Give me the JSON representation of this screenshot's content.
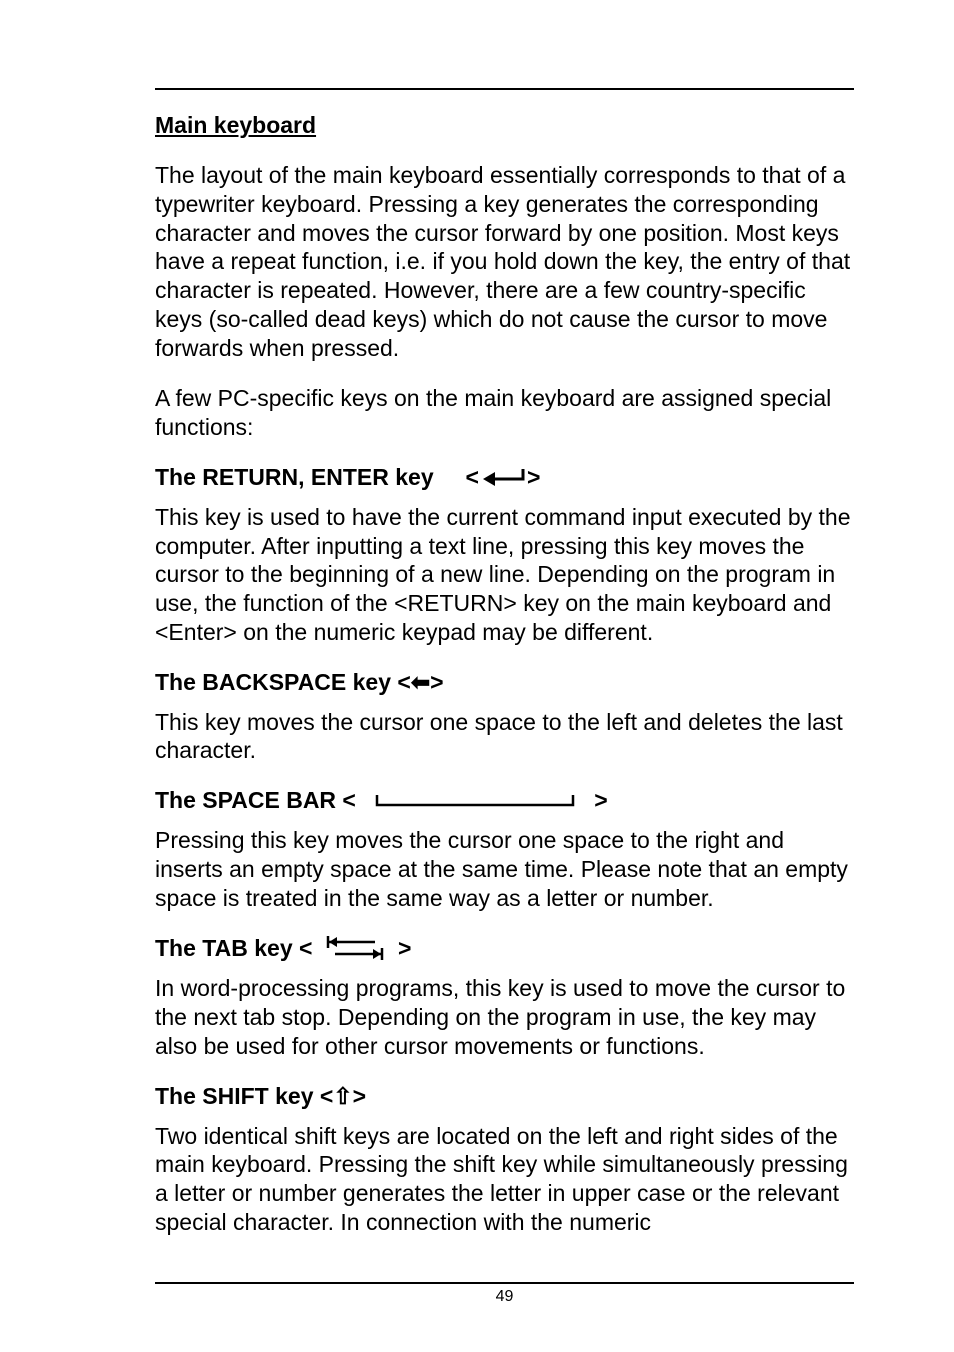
{
  "title": "Main keyboard",
  "intro_p1": "The layout of the main keyboard essentially corresponds to that of a typewriter keyboard. Pressing a key generates the corresponding character and moves the cursor forward by one position. Most keys have a repeat function, i.e. if you hold down the key, the entry of that character is repeated. However, there are a few country-specific keys (so-called dead keys) which do not cause the cursor to move forwards when pressed.",
  "intro_p2": "A few PC-specific keys on the main keyboard are assigned special functions:",
  "return": {
    "heading_prefix": "The RETURN, ENTER key     <",
    "heading_suffix": ">",
    "body": "This key is used to have the current command input executed by the computer. After inputting a text line, pressing this key moves the cursor to the beginning of a new line. Depending on the program in use, the function of the <RETURN> key on the main keyboard and <Enter> on the numeric keypad may be different."
  },
  "backspace": {
    "heading": "The BACKSPACE key <⬅>",
    "body": "This key moves the cursor one space to the left and deletes the last character."
  },
  "spacebar": {
    "heading_prefix": "The SPACE BAR <   ",
    "heading_suffix": "   >",
    "body": "Pressing this key moves the cursor one space to the right and inserts an empty space at the same time. Please note that an empty space is treated in the same way as a letter or number."
  },
  "tab": {
    "heading_prefix": "The TAB key <  ",
    "heading_suffix": "  >",
    "body": "In word-processing programs, this key is used to move the cursor to the next tab stop. Depending on the program in use, the key may also be used for other cursor movements or functions."
  },
  "shift": {
    "heading": "The SHIFT key <⇧>",
    "body": "Two identical shift keys are located on the left and right sides of the main keyboard. Pressing the shift key while simultaneously pressing a letter or number generates the letter in upper case or the relevant special character. In connection with the numeric"
  },
  "page_number": "49"
}
